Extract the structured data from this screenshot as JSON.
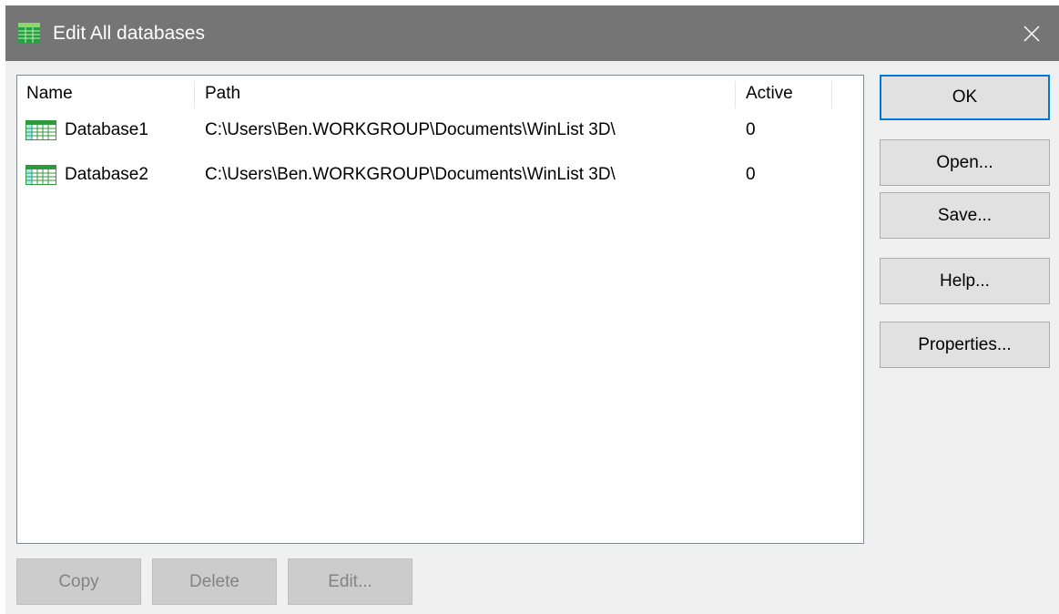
{
  "window": {
    "title": "Edit All databases"
  },
  "list": {
    "columns": [
      "Name",
      "Path",
      "Active"
    ],
    "rows": [
      {
        "name": "Database1",
        "path": "C:\\Users\\Ben.WORKGROUP\\Documents\\WinList 3D\\",
        "active": "0"
      },
      {
        "name": "Database2",
        "path": "C:\\Users\\Ben.WORKGROUP\\Documents\\WinList 3D\\",
        "active": "0"
      }
    ]
  },
  "buttons": {
    "ok": "OK",
    "open": "Open...",
    "save": "Save...",
    "help": "Help...",
    "properties": "Properties...",
    "copy": "Copy",
    "delete": "Delete",
    "edit": "Edit..."
  },
  "icons": {
    "app": "database-grid-icon",
    "row": "database-table-icon",
    "close": "close-icon"
  },
  "colors": {
    "titlebar": "#757575",
    "ok_border": "#0078d7"
  }
}
